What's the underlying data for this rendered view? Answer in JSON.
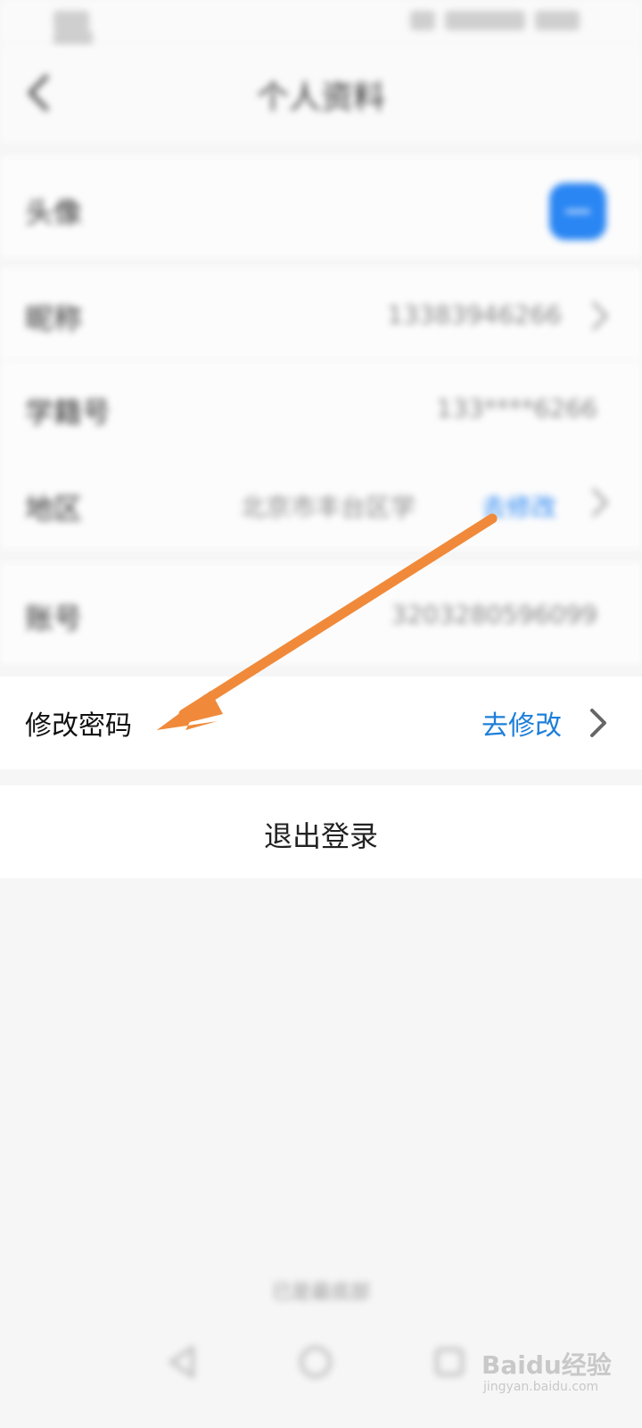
{
  "status_bar": {
    "left": "",
    "right": ""
  },
  "header": {
    "title": "个人资料"
  },
  "rows": {
    "avatar": {
      "label": "头像"
    },
    "nickname": {
      "label": "昵称",
      "value": "13383946266"
    },
    "student_id": {
      "label": "学籍号",
      "value": "133****6266"
    },
    "region": {
      "label": "地区",
      "value": "北京市丰台区学",
      "action": "去修改"
    },
    "account": {
      "label": "账号",
      "value": "3203280596099"
    }
  },
  "change_password": {
    "label": "修改密码",
    "action": "去修改"
  },
  "logout": {
    "label": "退出登录"
  },
  "footer": {
    "text": "已是最底部"
  },
  "watermark": {
    "main": "Baidu经验",
    "sub": "jingyan.baidu.com"
  },
  "colors": {
    "accent": "#1e7fd8",
    "arrow": "#f08a3a",
    "avatar": "#2a86f3"
  },
  "icons": {
    "back": "chevron-left-icon",
    "chevron": "chevron-right-icon"
  }
}
